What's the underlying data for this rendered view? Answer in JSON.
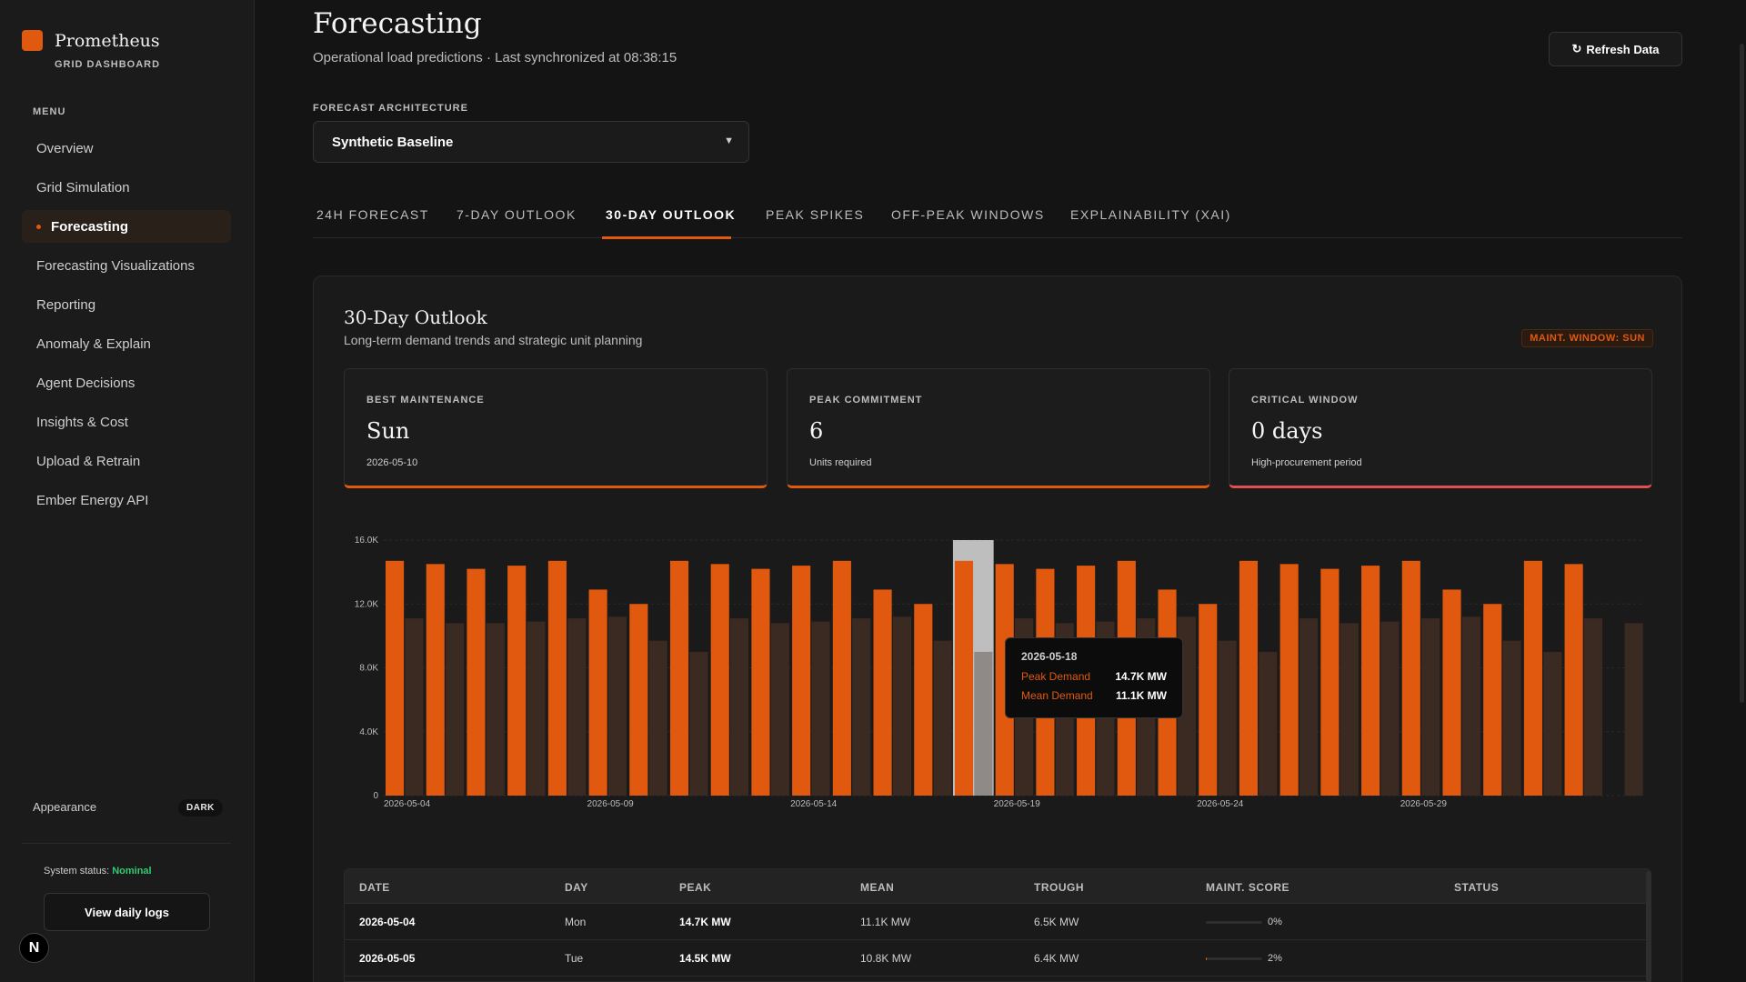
{
  "brand": {
    "name": "Prometheus",
    "subtitle": "GRID DASHBOARD"
  },
  "sidebar": {
    "menu_label": "MENU",
    "items": [
      {
        "label": "Overview",
        "active": false
      },
      {
        "label": "Grid Simulation",
        "active": false
      },
      {
        "label": "Forecasting",
        "active": true
      },
      {
        "label": "Forecasting Visualizations",
        "active": false
      },
      {
        "label": "Reporting",
        "active": false
      },
      {
        "label": "Anomaly & Explain",
        "active": false
      },
      {
        "label": "Agent Decisions",
        "active": false
      },
      {
        "label": "Insights & Cost",
        "active": false
      },
      {
        "label": "Upload & Retrain",
        "active": false
      },
      {
        "label": "Ember Energy API",
        "active": false
      }
    ],
    "appearance_label": "Appearance",
    "appearance_value": "DARK",
    "system_status_label": "System status:",
    "system_status_value": "Nominal",
    "logs_button": "View daily logs",
    "user_initial": "N"
  },
  "header": {
    "title": "Forecasting",
    "subtitle": "Operational load predictions · Last synchronized at 08:38:15",
    "refresh_label": "Refresh Data"
  },
  "architecture": {
    "label": "FORECAST ARCHITECTURE",
    "selected": "Synthetic Baseline"
  },
  "tabs": [
    {
      "label": "24H FORECAST"
    },
    {
      "label": "7-DAY OUTLOOK"
    },
    {
      "label": "30-DAY OUTLOOK"
    },
    {
      "label": "PEAK SPIKES"
    },
    {
      "label": "OFF-PEAK WINDOWS"
    },
    {
      "label": "EXPLAINABILITY (XAI)"
    }
  ],
  "panel": {
    "title": "30-Day Outlook",
    "subtitle": "Long-term demand trends and strategic unit planning",
    "badge": "MAINT. WINDOW: SUN",
    "cards": [
      {
        "label": "BEST MAINTENANCE",
        "value": "Sun",
        "note": "2026-05-10"
      },
      {
        "label": "PEAK COMMITMENT",
        "value": "6",
        "note": "Units required"
      },
      {
        "label": "CRITICAL WINDOW",
        "value": "0 days",
        "note": "High-procurement period"
      }
    ]
  },
  "tooltip": {
    "date": "2026-05-18",
    "peak_label": "Peak Demand",
    "peak_value": "14.7K MW",
    "mean_label": "Mean Demand",
    "mean_value": "11.1K MW"
  },
  "colors": {
    "accent": "#e0590f",
    "mean_bar": "#3a2a22",
    "ok": "#2ecc71",
    "critical": "#e0504f"
  },
  "chart_data": {
    "type": "bar",
    "categories": [
      "2026-05-04",
      "2026-05-05",
      "2026-05-06",
      "2026-05-07",
      "2026-05-08",
      "2026-05-09",
      "2026-05-10",
      "2026-05-11",
      "2026-05-12",
      "2026-05-13",
      "2026-05-14",
      "2026-05-15",
      "2026-05-16",
      "2026-05-17",
      "2026-05-18",
      "2026-05-19",
      "2026-05-20",
      "2026-05-21",
      "2026-05-22",
      "2026-05-23",
      "2026-05-24",
      "2026-05-25",
      "2026-05-26",
      "2026-05-27",
      "2026-05-28",
      "2026-05-29",
      "2026-05-30",
      "2026-05-31",
      "2026-06-01",
      "2026-06-02",
      "2026-06-03"
    ],
    "series": [
      {
        "name": "Peak Demand",
        "values": [
          14.7,
          14.5,
          14.2,
          14.4,
          14.7,
          12.9,
          12.0,
          14.7,
          14.5,
          14.2,
          14.4,
          14.7,
          12.9,
          12.0,
          14.7,
          14.5,
          14.2,
          14.4,
          14.7,
          12.9,
          12.0,
          14.7,
          14.5,
          14.2,
          14.4,
          14.7,
          12.9,
          12.0,
          14.7,
          14.5,
          null
        ]
      },
      {
        "name": "Mean Demand",
        "values": [
          11.1,
          10.8,
          10.8,
          10.9,
          11.1,
          11.2,
          9.7,
          9.0,
          11.1,
          10.8,
          10.9,
          11.1,
          11.2,
          9.7,
          9.0,
          11.1,
          10.8,
          10.9,
          11.1,
          11.2,
          9.7,
          9.0,
          11.1,
          10.8,
          10.9,
          11.1,
          11.2,
          9.7,
          9.0,
          11.1,
          10.8
        ]
      }
    ],
    "y_ticks": [
      "0",
      "4.0K",
      "8.0K",
      "12.0K",
      "16.0K"
    ],
    "x_ticks": [
      "2026-05-04",
      "2026-05-09",
      "2026-05-14",
      "2026-05-19",
      "2026-05-24",
      "2026-05-29"
    ],
    "ylim": [
      0,
      16
    ],
    "grid": true,
    "highlight_index": 14
  },
  "table": {
    "columns": [
      "DATE",
      "DAY",
      "PEAK",
      "MEAN",
      "TROUGH",
      "MAINT. SCORE",
      "STATUS"
    ],
    "rows": [
      {
        "date": "2026-05-04",
        "day": "Mon",
        "peak": "14.7K MW",
        "mean": "11.1K MW",
        "trough": "6.5K MW",
        "score": "0%",
        "score_frac": 0.0,
        "status": ""
      },
      {
        "date": "2026-05-05",
        "day": "Tue",
        "peak": "14.5K MW",
        "mean": "10.8K MW",
        "trough": "6.4K MW",
        "score": "2%",
        "score_frac": 0.02,
        "status": ""
      }
    ]
  }
}
